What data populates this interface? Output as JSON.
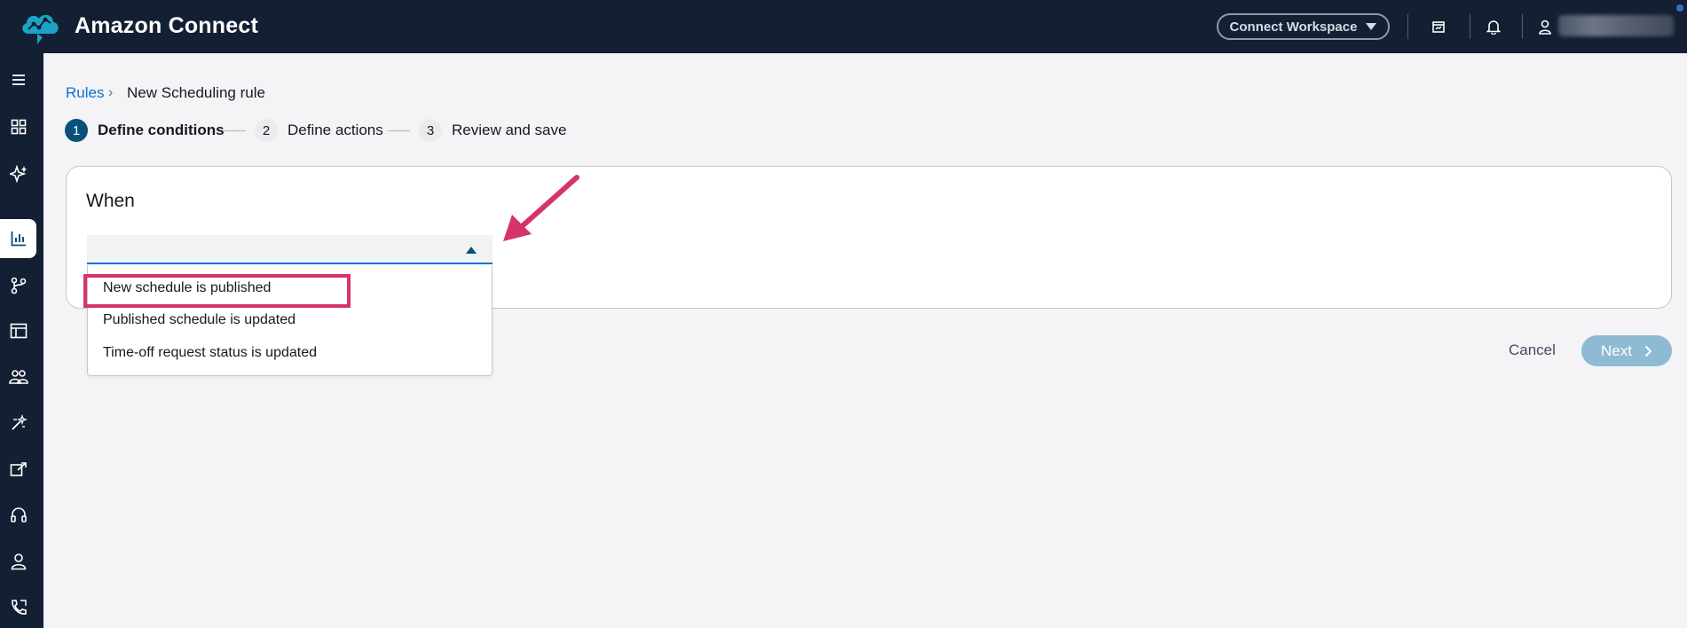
{
  "header": {
    "app_title": "Amazon Connect",
    "workspace_label": "Connect Workspace",
    "user_name": "██████ ████ █"
  },
  "nav": {
    "items": [
      "menu-icon",
      "dashboard-icon",
      "sparkle-icon",
      "analytics-icon",
      "routing-icon",
      "table-icon",
      "users-icon",
      "magic-icon",
      "export-icon",
      "headset-icon",
      "person-icon",
      "phone-icon"
    ],
    "active_index": 3
  },
  "breadcrumb": {
    "parent": "Rules",
    "current": "New Scheduling rule"
  },
  "steps": [
    {
      "number": "1",
      "label": "Define conditions",
      "active": true
    },
    {
      "number": "2",
      "label": "Define actions",
      "active": false
    },
    {
      "number": "3",
      "label": "Review and save",
      "active": false
    }
  ],
  "card": {
    "title": "When"
  },
  "dropdown": {
    "selected_value": "",
    "options": [
      "New schedule is published",
      "Published schedule is updated",
      "Time-off request status is updated"
    ]
  },
  "actions": {
    "cancel_label": "Cancel",
    "next_label": "Next"
  },
  "colors": {
    "topbar": "#131f33",
    "link": "#0972d3",
    "highlight": "#d63469",
    "next_disabled": "#8fbad3"
  }
}
